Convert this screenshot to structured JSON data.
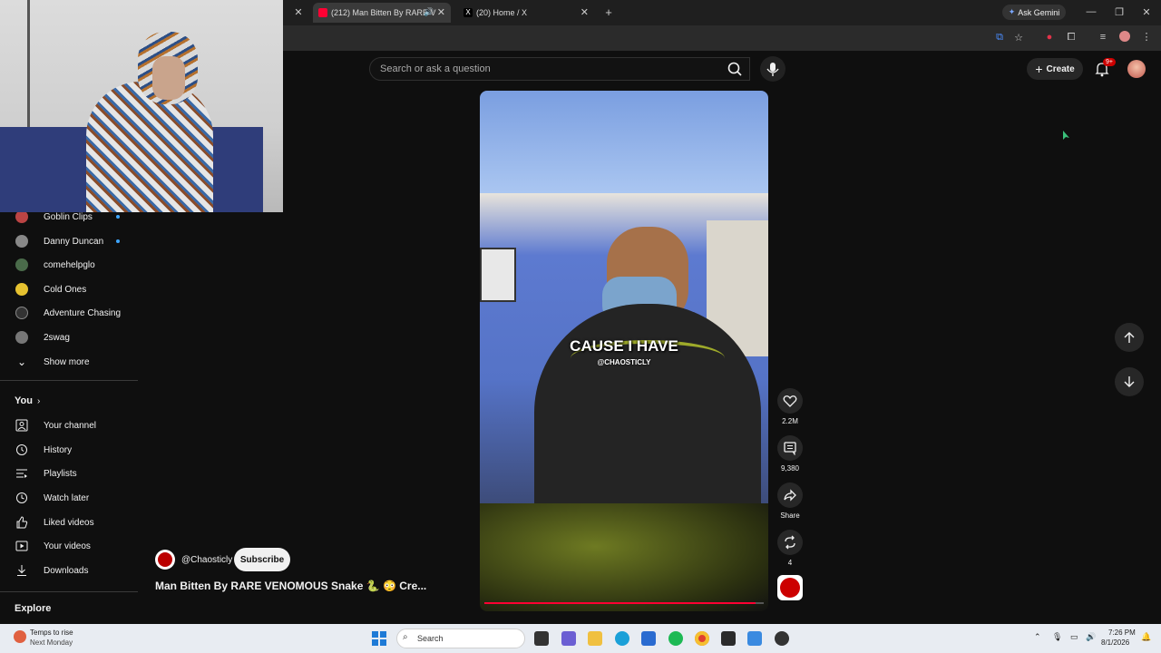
{
  "browser": {
    "tabs": [
      {
        "label": "(212) Man Bitten By RARE V",
        "active": true
      },
      {
        "label": "(20) Home / X",
        "active": false
      }
    ],
    "new_tab": "+",
    "ask_gemini": "Ask Gemini",
    "window_controls": {
      "minimize": "—",
      "restore": "❐",
      "close": "✕"
    }
  },
  "header": {
    "search_placeholder": "Search or ask a question",
    "create_label": "Create",
    "notification_badge": "9+"
  },
  "sidebar": {
    "subscriptions": [
      {
        "label": "Goblin Clips",
        "new": true
      },
      {
        "label": "Danny Duncan",
        "new": true
      },
      {
        "label": "comehelpglo",
        "new": false
      },
      {
        "label": "Cold Ones",
        "new": false
      },
      {
        "label": "Adventure Chasing",
        "new": false
      },
      {
        "label": "2swag",
        "new": false
      }
    ],
    "show_more": "Show more",
    "you_heading": "You",
    "you_items": [
      {
        "label": "Your channel",
        "icon": "person-icon"
      },
      {
        "label": "History",
        "icon": "history-icon"
      },
      {
        "label": "Playlists",
        "icon": "playlists-icon"
      },
      {
        "label": "Watch later",
        "icon": "clock-icon"
      },
      {
        "label": "Liked videos",
        "icon": "thumbs-up-icon"
      },
      {
        "label": "Your videos",
        "icon": "play-icon"
      },
      {
        "label": "Downloads",
        "icon": "download-icon"
      }
    ],
    "explore_heading": "Explore"
  },
  "video": {
    "caption": "CAUSE I HAVE",
    "watermark": "@CHAOSTICLY",
    "progress_fraction": 0.97
  },
  "actions": {
    "likes": "2.2M",
    "comments": "9,380",
    "share": "Share",
    "remix": "4"
  },
  "channel": {
    "name": "@Chaosticly",
    "subscribe": "Subscribe"
  },
  "title": "Man Bitten By RARE VENOMOUS Snake 🐍 😳 Cre...",
  "taskbar": {
    "weather_line1": "Temps to rise",
    "weather_line2": "Next Monday",
    "search": "Search",
    "time": "7:26 PM",
    "date": "8/1/2026"
  }
}
